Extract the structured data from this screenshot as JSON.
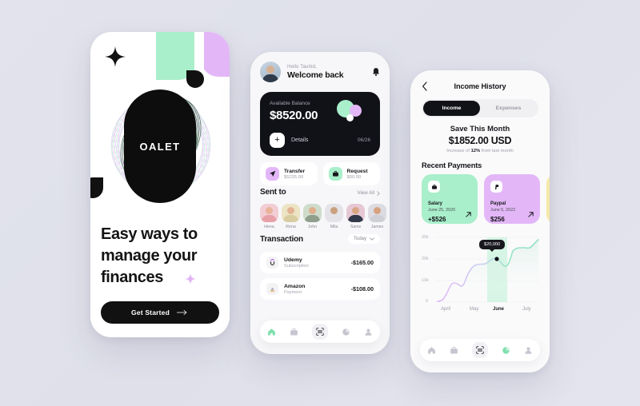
{
  "background": {
    "accent_green": "#a9efcb",
    "accent_purple": "#e3b7f7",
    "accent_yellow": "#f6e9a8",
    "dark": "#111217"
  },
  "phone1": {
    "logo_text": "OALET",
    "headline": "Easy ways to manage your finances",
    "cta_label": "Get Started",
    "cta_icon": "arrow-right-icon",
    "sparkle_icon": "sparkle-icon"
  },
  "phone2": {
    "greeting_small": "Hello Tauhid,",
    "greeting_main": "Welcome back",
    "bell_icon": "bell-icon",
    "balance": {
      "label": "Available Balance",
      "amount": "$8520.00",
      "details_label": "Details",
      "plus_icon": "plus-icon",
      "date": "06/26"
    },
    "quick_actions": [
      {
        "title": "Transfer",
        "amount": "$5235.00",
        "icon": "send-icon",
        "color": "purple"
      },
      {
        "title": "Request",
        "amount": "$00.00",
        "icon": "briefcase-icon",
        "color": "green"
      }
    ],
    "sent_to": {
      "title": "Sent to",
      "view_all": "View All",
      "chevron_icon": "chevron-right-icon",
      "people": [
        {
          "name": "Hena",
          "skin": "#e8b49a",
          "shirt": "#e8a0a8",
          "bg": "#f2cdd4"
        },
        {
          "name": "Rena",
          "skin": "#e3b394",
          "shirt": "#d8cda0",
          "bg": "#ece4c4"
        },
        {
          "name": "John",
          "skin": "#dfae8b",
          "shirt": "#8f9f8c",
          "bg": "#cfdccb"
        },
        {
          "name": "Mila",
          "skin": "#caa07e",
          "shirt": "#e4e4e8",
          "bg": "#e3e3e8"
        },
        {
          "name": "Sams",
          "skin": "#d9a585",
          "shirt": "#31394a",
          "bg": "#e6c7d4"
        },
        {
          "name": "James",
          "skin": "#d7a27f",
          "shirt": "#cfcfd6",
          "bg": "#dcdce2"
        }
      ]
    },
    "transaction": {
      "title": "Transaction",
      "filter_label": "Today",
      "filter_icon": "chevron-down-icon",
      "rows": [
        {
          "name": "Udemy",
          "sub": "Subscription",
          "amount": "-$165.00",
          "logo": "udemy-logo"
        },
        {
          "name": "Amazon",
          "sub": "Payment",
          "amount": "-$108.00",
          "logo": "amazon-logo"
        }
      ]
    },
    "nav": [
      {
        "icon": "home-icon",
        "active": true
      },
      {
        "icon": "briefcase-icon",
        "active": false
      },
      {
        "icon": "scan-icon",
        "active": false
      },
      {
        "icon": "pie-chart-icon",
        "active": false
      },
      {
        "icon": "person-icon",
        "active": false
      }
    ]
  },
  "phone3": {
    "back_icon": "chevron-left-icon",
    "title": "Income History",
    "tabs": [
      {
        "label": "Income",
        "active": true
      },
      {
        "label": "Expenses",
        "active": false
      }
    ],
    "summary": {
      "label": "Save This Month",
      "amount": "$1852.00 USD",
      "note_prefix": "Increase of ",
      "note_value": "12%",
      "note_suffix": " from last month"
    },
    "recent_payments": {
      "title": "Recent Payments",
      "cards": [
        {
          "name": "Salary",
          "date": "June 25, 2020",
          "amount": "+$526",
          "color": "green",
          "icon": "briefcase-icon",
          "arrow": "arrow-up-right-icon"
        },
        {
          "name": "Paypal",
          "date": "June 5, 2022",
          "amount": "$256",
          "color": "purple",
          "icon": "paypal-icon",
          "arrow": "arrow-up-right-icon"
        },
        {
          "name": "",
          "date": "",
          "amount": "",
          "color": "yellow",
          "icon": "",
          "arrow": ""
        }
      ]
    },
    "nav": [
      {
        "icon": "home-icon",
        "active": false
      },
      {
        "icon": "briefcase-icon",
        "active": false
      },
      {
        "icon": "scan-icon",
        "active": false
      },
      {
        "icon": "pie-chart-icon",
        "active": true
      },
      {
        "icon": "person-icon",
        "active": false
      }
    ]
  },
  "chart_data": {
    "type": "area",
    "title": "Income History",
    "x": [
      "April",
      "May",
      "June",
      "July"
    ],
    "xlabel": "",
    "ylabel": "",
    "ytick_labels": [
      "0",
      "10k",
      "20k",
      "30k"
    ],
    "ytick_values": [
      0,
      10000,
      20000,
      30000
    ],
    "ylim": [
      0,
      30000
    ],
    "grid": true,
    "legend": "none",
    "highlight_month": "June",
    "tooltip_label": "$20,000",
    "tooltip_point": {
      "x": "June",
      "y": 20000
    },
    "series": [
      {
        "name": "Income",
        "values": [
          400,
          1200,
          6500,
          6800,
          7300,
          11500,
          12200,
          14000,
          20000,
          19000,
          24500,
          24000,
          27000
        ]
      }
    ]
  }
}
